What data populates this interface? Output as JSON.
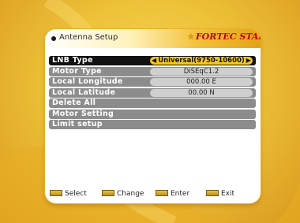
{
  "header": {
    "title": "Antenna Setup",
    "brand": "FORTEC STAR"
  },
  "menu": [
    {
      "label": "LNB Type",
      "value": "Universal(9750-10600)",
      "selected": true
    },
    {
      "label": "Motor Type",
      "value": "DiSEqC1.2"
    },
    {
      "label": "Local Longitude",
      "value": "000.00  E"
    },
    {
      "label": "Local Latitude",
      "value": "00.00  N"
    },
    {
      "label": "Delete All"
    },
    {
      "label": "Motor Setting"
    },
    {
      "label": "Limit setup"
    }
  ],
  "footer": {
    "select": "Select",
    "change": "Change",
    "enter": "Enter",
    "exit": "Exit"
  },
  "colors": {
    "background": "#eec23a",
    "selected_row": "#111111",
    "selected_value": "#f7c81b",
    "row": "#8c8c8c",
    "brand": "#c0001a"
  }
}
